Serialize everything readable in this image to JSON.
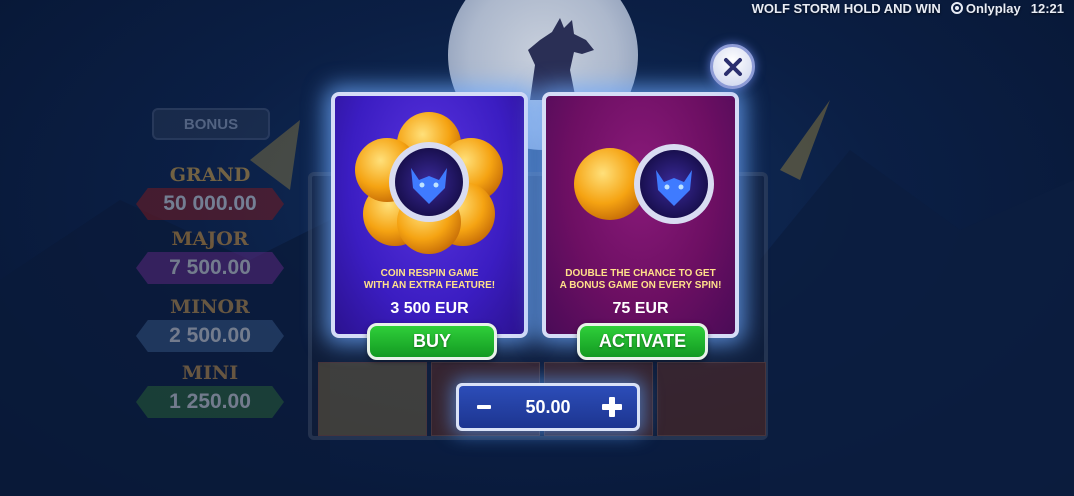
{
  "top_bar": {
    "game_title": "WOLF STORM HOLD AND WIN",
    "brand": "Onlyplay",
    "clock": "12:21"
  },
  "jackpots": {
    "bonus_label": "BONUS",
    "grand": {
      "name": "GRAND",
      "value": "50 000.00"
    },
    "major": {
      "name": "MAJOR",
      "value": "7 500.00"
    },
    "minor": {
      "name": "MINOR",
      "value": "2 500.00"
    },
    "mini": {
      "name": "MINI",
      "value": "1 250.00"
    }
  },
  "popup": {
    "offers": [
      {
        "description": "COIN RESPIN GAME\nWITH AN EXTRA FEATURE!",
        "price": "3 500 EUR",
        "button_label": "BUY",
        "icon": "wolf-coin-flower-icon"
      },
      {
        "description": "DOUBLE THE CHANCE TO GET\nA BONUS GAME ON EVERY SPIN!",
        "price": "75 EUR",
        "button_label": "ACTIVATE",
        "icon": "wolf-coin-pair-icon"
      }
    ],
    "close_icon": "close-icon"
  },
  "bet": {
    "value": "50.00",
    "decrease_icon": "minus-icon",
    "increase_icon": "plus-icon"
  },
  "colors": {
    "card_blue": "#3b1dc2",
    "card_pink": "#6d0f63",
    "button_green": "#1fb52d",
    "desc_yellow": "#ffe08a"
  }
}
